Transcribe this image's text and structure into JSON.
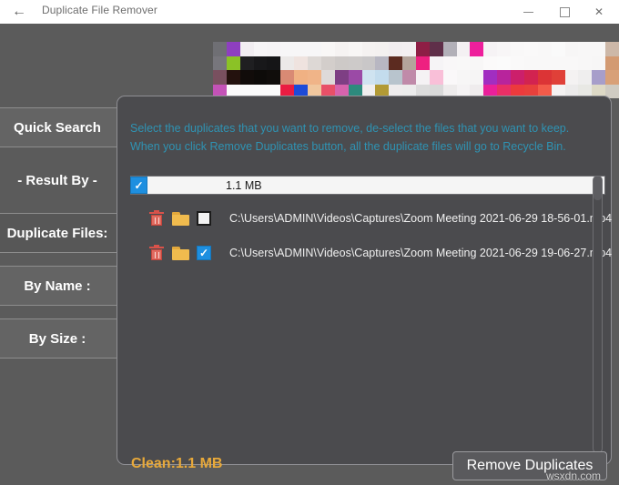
{
  "window": {
    "title": "Duplicate File Remover",
    "back_icon": "back-arrow-icon",
    "minimize_label": "─",
    "maximize_label": "□",
    "close_label": "✕"
  },
  "sidebar": {
    "items": [
      {
        "label": "Quick Search",
        "style": "button",
        "active": false
      },
      {
        "label": "- Result By -",
        "style": "flat",
        "active": false
      },
      {
        "label": "Duplicate Files:",
        "style": "button",
        "active": true
      },
      {
        "label": "By Name :",
        "style": "button",
        "active": false
      },
      {
        "label": "By Size :",
        "style": "button",
        "active": false
      }
    ]
  },
  "dialog": {
    "note": "Select the duplicates that you want to remove, de-select the files that you want to keep. When you click Remove Duplicates button, all the duplicate files will go to Recycle Bin.",
    "note_color": "#2f93b3",
    "group": {
      "checked": true,
      "size_label": "1.1 MB",
      "check_glyph": "✓"
    },
    "files": [
      {
        "path": "C:\\Users\\ADMIN\\Videos\\Captures\\Zoom Meeting 2021-06-29 18-56-01.mp4",
        "checked": false,
        "trash_icon": "trash-icon",
        "folder_icon": "folder-icon",
        "check_glyph": "✓"
      },
      {
        "path": "C:\\Users\\ADMIN\\Videos\\Captures\\Zoom Meeting 2021-06-29 19-06-27.mp4",
        "checked": true,
        "trash_icon": "trash-icon",
        "folder_icon": "folder-icon",
        "check_glyph": "✓"
      }
    ]
  },
  "footer": {
    "clean_label": "Clean:1.1 MB",
    "clean_color": "#e8a93a",
    "remove_button_label": "Remove Duplicates"
  },
  "watermark": {
    "text": "wsxdn.com"
  },
  "mosaic": {
    "colors": [
      "#6f6f74",
      "#8e3fc0",
      "#f2eef2",
      "#f7f5f7",
      "#f6f4f6",
      "#f7f6f7",
      "#f7f6f7",
      "#f7f6f7",
      "#f9f7f6",
      "#f6f3f2",
      "#f8f6f5",
      "#f5f2f1",
      "#f4f1f0",
      "#f2eef0",
      "#f3eff1",
      "#8e1e45",
      "#5f2f49",
      "#b2b0b8",
      "#f4f1f3",
      "#ee1f9c",
      "#f6f3f5",
      "#f8f6f7",
      "#f9f8f8",
      "#faf9f9",
      "#f9f8f8",
      "#fafafa",
      "#f7f6f6",
      "#f8f7f7",
      "#f8f7f7",
      "#cdb8a8",
      "#77767c",
      "#8bc226",
      "#1f1f21",
      "#18181a",
      "#151517",
      "#ece9e8",
      "#efe3df",
      "#ddd8d5",
      "#d3cecb",
      "#cdc9c7",
      "#cdcac9",
      "#c9c7c8",
      "#b8b7c2",
      "#5c2b20",
      "#b3a49b",
      "#ee2080",
      "#f6f4f6",
      "#f9f7f8",
      "#f9f8f8",
      "#f8f7f7",
      "#fbfafa",
      "#fbfbfb",
      "#faf9f9",
      "#f9f8f8",
      "#f9f8f8",
      "#f9f8f8",
      "#f9f8f8",
      "#f8f7f7",
      "#f7f6f6",
      "#d39a72",
      "#79505f",
      "#24120e",
      "#110c0a",
      "#0d0b09",
      "#100d0b",
      "#d98a74",
      "#f0b183",
      "#f0b488",
      "#dedad9",
      "#7e3f84",
      "#9b4aa6",
      "#cfe3f0",
      "#c3dced",
      "#b8c4cd",
      "#c08aa9",
      "#f5f2f4",
      "#f9bfd8",
      "#faf8f9",
      "#f7f6f6",
      "#f6f5f5",
      "#a12ec1",
      "#b8249c",
      "#cc1f6b",
      "#d22350",
      "#dc3436",
      "#e04038",
      "#f4f2f2",
      "#efeeee",
      "#a79eca",
      "#d8a078",
      "#c452b7",
      "#fbfafa",
      "#fbfbfb",
      "#fbfbfb",
      "#fbfbfb",
      "#ea1c42",
      "#1e4bd8",
      "#f0c79e",
      "#e85068",
      "#d663ad",
      "#2d8a7d",
      "#f0eeee",
      "#b29a35",
      "#eeeced",
      "#ececec",
      "#dcdcdc",
      "#d9d9d9",
      "#eeecec",
      "#f5f3f4",
      "#efeced",
      "#e9209a",
      "#e92f66",
      "#ec3a3d",
      "#e8403c",
      "#f35b4a",
      "#f4f2f2",
      "#ecebeb",
      "#e8e8e4",
      "#ddd9c6",
      "#cfcbc2"
    ]
  }
}
